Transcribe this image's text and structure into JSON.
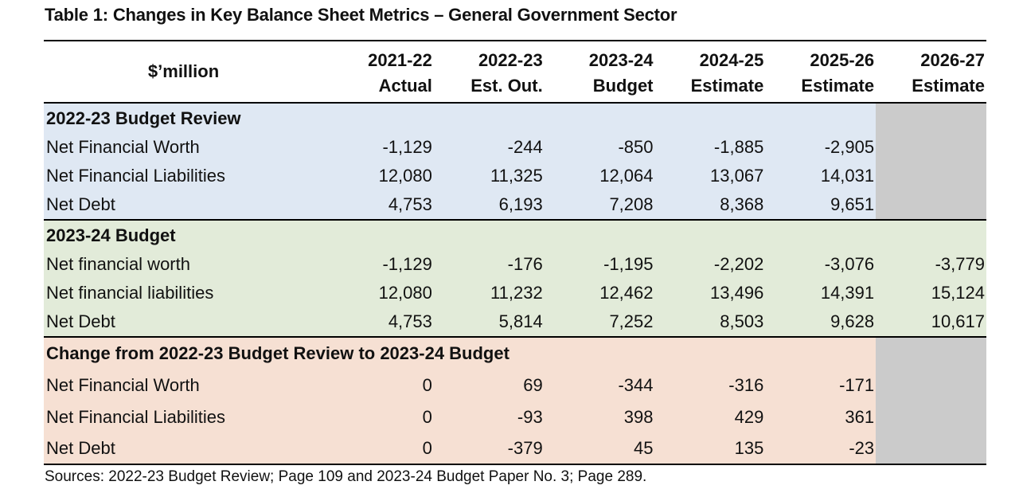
{
  "title": "Table 1: Changes in Key Balance Sheet Metrics – General Government Sector",
  "header": {
    "label": "$’million",
    "columns": [
      {
        "year": "2021-22",
        "type": "Actual"
      },
      {
        "year": "2022-23",
        "type": "Est. Out."
      },
      {
        "year": "2023-24",
        "type": "Budget"
      },
      {
        "year": "2024-25",
        "type": "Estimate"
      },
      {
        "year": "2025-26",
        "type": "Estimate"
      },
      {
        "year": "2026-27",
        "type": "Estimate"
      }
    ]
  },
  "sections": [
    {
      "heading": "2022-23 Budget Review",
      "rows": [
        {
          "label": "Net Financial Worth",
          "values": [
            "-1,129",
            "-244",
            "-850",
            "-1,885",
            "-2,905",
            ""
          ]
        },
        {
          "label": "Net Financial Liabilities",
          "values": [
            "12,080",
            "11,325",
            "12,064",
            "13,067",
            "14,031",
            ""
          ]
        },
        {
          "label": "Net Debt",
          "values": [
            "4,753",
            "6,193",
            "7,208",
            "8,368",
            "9,651",
            ""
          ]
        }
      ]
    },
    {
      "heading": "2023-24 Budget",
      "rows": [
        {
          "label": "Net financial worth",
          "values": [
            "-1,129",
            "-176",
            "-1,195",
            "-2,202",
            "-3,076",
            "-3,779"
          ]
        },
        {
          "label": "Net financial liabilities",
          "values": [
            "12,080",
            "11,232",
            "12,462",
            "13,496",
            "14,391",
            "15,124"
          ]
        },
        {
          "label": "Net Debt",
          "values": [
            "4,753",
            "5,814",
            "7,252",
            "8,503",
            "9,628",
            "10,617"
          ]
        }
      ]
    },
    {
      "heading": "Change from 2022-23 Budget Review to 2023-24 Budget",
      "rows": [
        {
          "label": "Net Financial Worth",
          "values": [
            "0",
            "69",
            "-344",
            "-316",
            "-171",
            ""
          ]
        },
        {
          "label": "Net Financial Liabilities",
          "values": [
            "0",
            "-93",
            "398",
            "429",
            "361",
            ""
          ]
        },
        {
          "label": "Net Debt",
          "values": [
            "0",
            "-379",
            "45",
            "135",
            "-23",
            ""
          ]
        }
      ]
    }
  ],
  "sources": "Sources: 2022-23 Budget Review; Page 109 and 2023-24 Budget Paper No. 3; Page 289.",
  "colors": {
    "section1_bg": "#dfe8f3",
    "section2_bg": "#e2ebd9",
    "section3_bg": "#f6e0d3",
    "unavailable_bg": "#cbcbcb"
  }
}
